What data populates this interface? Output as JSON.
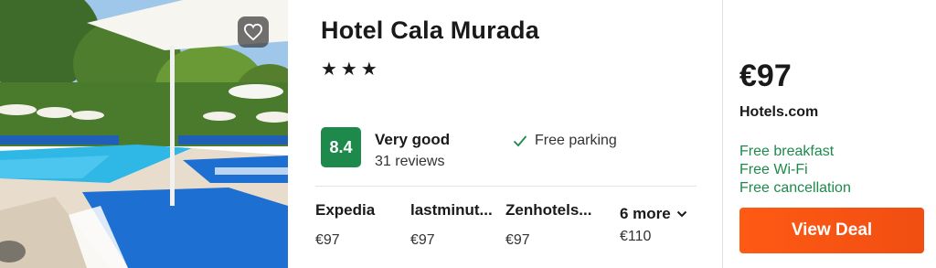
{
  "hotel": {
    "name": "Hotel Cala Murada",
    "stars": "★★★",
    "star_count": 3
  },
  "rating": {
    "score": "8.4",
    "label": "Very good",
    "reviews": "31 reviews"
  },
  "amenities": [
    {
      "icon": "check-icon",
      "label": "Free parking"
    }
  ],
  "providers": [
    {
      "name": "Expedia",
      "price": "€97"
    },
    {
      "name": "lastminut...",
      "price": "€97"
    },
    {
      "name": "Zenhotels...",
      "price": "€97"
    }
  ],
  "more": {
    "label": "6 more",
    "price": "€110",
    "icon": "chevron-down-icon"
  },
  "deal": {
    "price": "€97",
    "vendor": "Hotels.com",
    "perks": [
      "Free breakfast",
      "Free Wi-Fi",
      "Free cancellation"
    ],
    "button_label": "View Deal"
  },
  "icons": {
    "favorite": "heart-icon"
  },
  "colors": {
    "rating_badge": "#1d8a4b",
    "perk_text": "#1d8a4b",
    "cta": "#ff5a14"
  }
}
